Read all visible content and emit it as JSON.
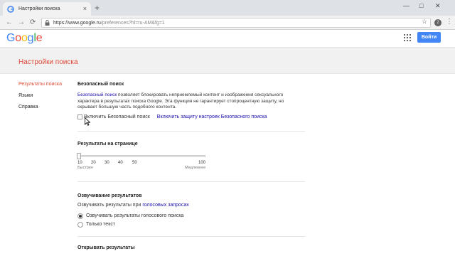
{
  "browser": {
    "tab_title": "Настройки поиска",
    "new_tab": "+",
    "url_main": "https://www.google.ru",
    "url_path": "/preferences?hl=ru-AM&fg=1",
    "win_minimize": "—",
    "win_maximize": "□",
    "win_close": "✕",
    "ext_label": "2",
    "menu": "⋮",
    "back": "←",
    "forward": "→",
    "reload": "⟳",
    "star": "☆"
  },
  "header": {
    "logo": [
      "G",
      "o",
      "o",
      "g",
      "l",
      "e"
    ],
    "logo_colors": [
      "#4285f4",
      "#ea4335",
      "#fbbc05",
      "#4285f4",
      "#34a853",
      "#ea4335"
    ],
    "signin": "Войти"
  },
  "page": {
    "title": "Настройки поиска"
  },
  "leftnav": {
    "items": [
      {
        "label": "Результаты поиска",
        "active": true
      },
      {
        "label": "Языки",
        "active": false
      },
      {
        "label": "Справка",
        "active": false
      }
    ]
  },
  "safesearch": {
    "title": "Безопасный поиск",
    "desc_link": "Безопасный поиск",
    "desc_rest": " позволяет блокировать неприемлемый контент и изображения сексуального характера в результатах поиска Google. Эта функция не гарантирует стопроцентную защиту, но скрывает большую часть подобного контента.",
    "checkbox_label": "Включить Безопасный поиск",
    "checkbox_checked": false,
    "lock_link": "Включить защиту настроек Безопасного поиска"
  },
  "results_per_page": {
    "title": "Результаты на странице",
    "ticks": [
      "10",
      "20",
      "30",
      "40",
      "50",
      "100"
    ],
    "min_label": "Быстрее",
    "max_label": "Медленнее",
    "value": 10
  },
  "spoken": {
    "title": "Озвучивание результатов",
    "desc_before": "Озвучивать результаты при ",
    "desc_link": "голосовых запросах",
    "options": [
      {
        "label": "Озвучивать результаты голосового поиска",
        "selected": true
      },
      {
        "label": "Только текст",
        "selected": false
      }
    ]
  },
  "open_results": {
    "title": "Открывать результаты"
  }
}
